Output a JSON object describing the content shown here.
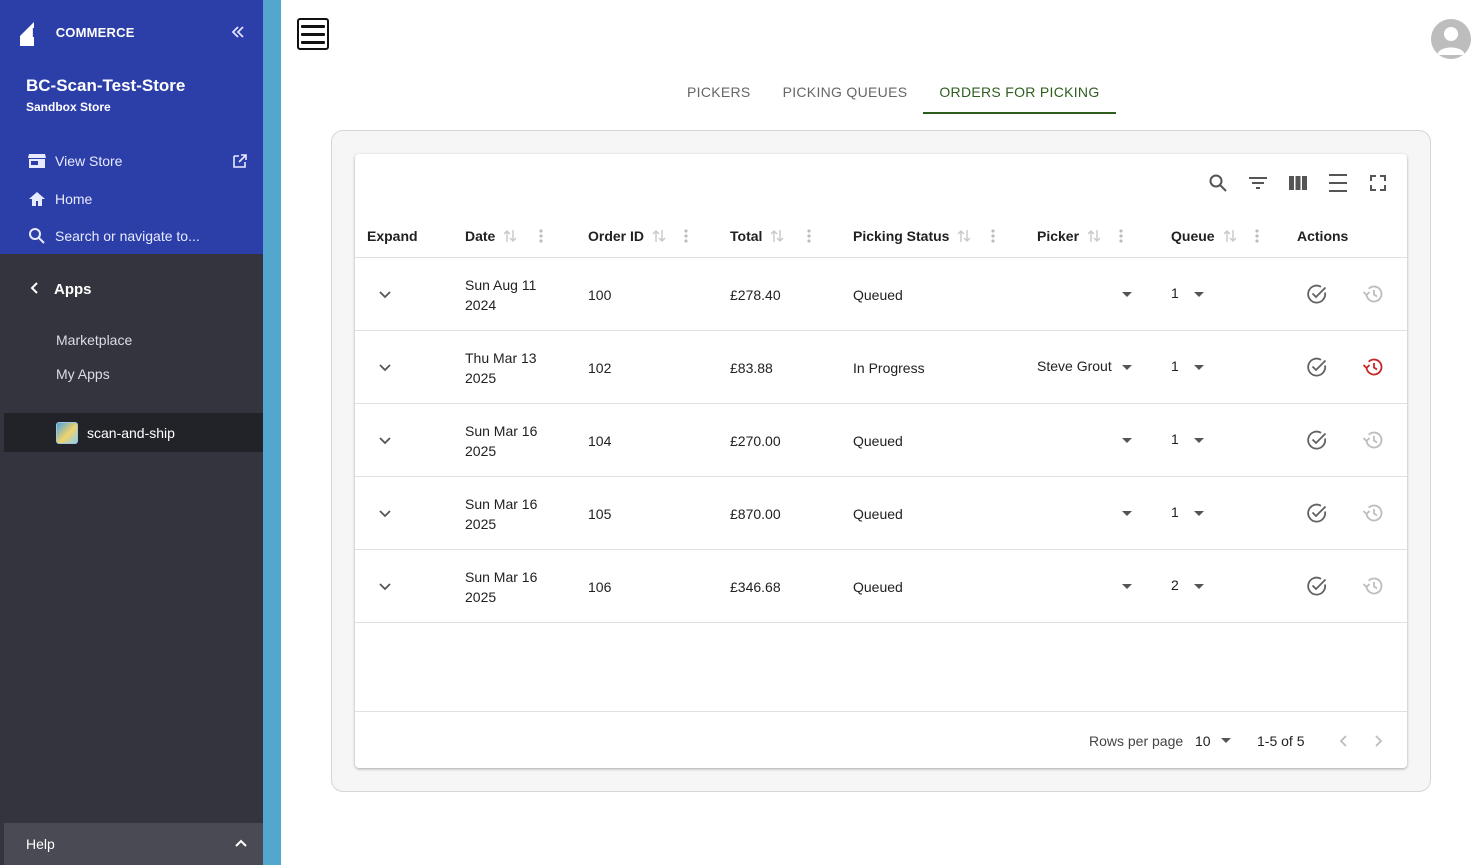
{
  "sidebar": {
    "logo": {
      "big": "BIG",
      "rest": "COMMERCE"
    },
    "store_name": "BC-Scan-Test-Store",
    "store_sub": "Sandbox Store",
    "view_store": "View Store",
    "home": "Home",
    "search": "Search or navigate to...",
    "apps": "Apps",
    "marketplace": "Marketplace",
    "my_apps": "My Apps",
    "selected_app": "scan-and-ship",
    "help": "Help"
  },
  "tabs": [
    {
      "label": "PICKERS",
      "active": false
    },
    {
      "label": "PICKING QUEUES",
      "active": false
    },
    {
      "label": "ORDERS FOR PICKING",
      "active": true
    }
  ],
  "table": {
    "headers": {
      "expand": "Expand",
      "date": "Date",
      "order_id": "Order ID",
      "total": "Total",
      "picking_status": "Picking Status",
      "picker": "Picker",
      "queue": "Queue",
      "actions": "Actions"
    },
    "rows": [
      {
        "date1": "Sun Aug 11",
        "date2": "2024",
        "order_id": "100",
        "total": "£278.40",
        "status": "Queued",
        "picker": "",
        "queue": "1",
        "history_active": false
      },
      {
        "date1": "Thu Mar 13",
        "date2": "2025",
        "order_id": "102",
        "total": "£83.88",
        "status": "In Progress",
        "picker": "Steve Grout",
        "queue": "1",
        "history_active": true
      },
      {
        "date1": "Sun Mar 16",
        "date2": "2025",
        "order_id": "104",
        "total": "£270.00",
        "status": "Queued",
        "picker": "",
        "queue": "1",
        "history_active": false
      },
      {
        "date1": "Sun Mar 16",
        "date2": "2025",
        "order_id": "105",
        "total": "£870.00",
        "status": "Queued",
        "picker": "",
        "queue": "1",
        "history_active": false
      },
      {
        "date1": "Sun Mar 16",
        "date2": "2025",
        "order_id": "106",
        "total": "£346.68",
        "status": "Queued",
        "picker": "",
        "queue": "2",
        "history_active": false
      }
    ],
    "footer": {
      "rows_per_page_label": "Rows per page",
      "rows_per_page_value": "10",
      "range": "1-5 of 5"
    }
  },
  "colors": {
    "sidebar_top": "#2c3ea8",
    "sidebar_bg": "#34343f",
    "active_tab": "#2e5e1f",
    "history_active": "#c62828",
    "history_inactive": "#bdbdbd"
  }
}
